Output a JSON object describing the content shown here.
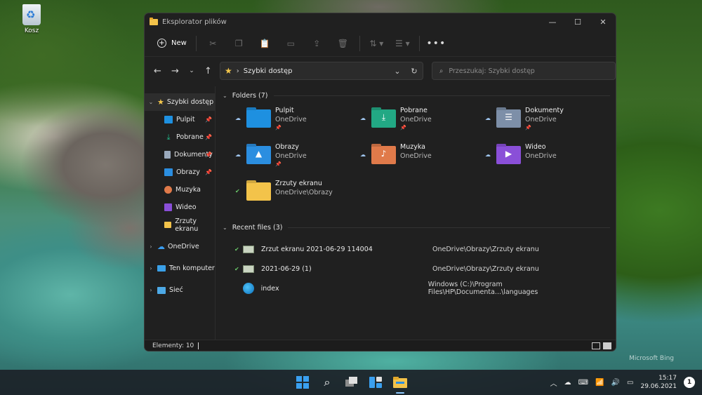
{
  "desktop": {
    "recycle_bin": "Kosz",
    "watermark": "Microsoft Bing"
  },
  "window": {
    "title": "Eksplorator plików"
  },
  "toolbar": {
    "new_label": "New",
    "more_label": "•••"
  },
  "address": {
    "path": "Szybki dostęp",
    "search_placeholder": "Przeszukaj: Szybki dostęp"
  },
  "sidebar": {
    "quick_access": "Szybki dostęp",
    "items": [
      {
        "label": "Pulpit",
        "pinned": true
      },
      {
        "label": "Pobrane",
        "pinned": true
      },
      {
        "label": "Dokumenty",
        "pinned": true
      },
      {
        "label": "Obrazy",
        "pinned": true
      },
      {
        "label": "Muzyka",
        "pinned": false
      },
      {
        "label": "Wideo",
        "pinned": false
      },
      {
        "label": "Zrzuty ekranu",
        "pinned": false
      }
    ],
    "onedrive": "OneDrive",
    "this_pc": "Ten komputer",
    "network": "Sieć"
  },
  "folders": {
    "header": "Folders (7)",
    "items": [
      {
        "name": "Pulpit",
        "location": "OneDrive",
        "color": "#1e90e0"
      },
      {
        "name": "Pobrane",
        "location": "OneDrive",
        "color": "#22a884"
      },
      {
        "name": "Dokumenty",
        "location": "OneDrive",
        "color": "#7d8fa8"
      },
      {
        "name": "Obrazy",
        "location": "OneDrive",
        "color": "#2b8ee0"
      },
      {
        "name": "Muzyka",
        "location": "OneDrive",
        "color": "#e07a4a"
      },
      {
        "name": "Wideo",
        "location": "OneDrive",
        "color": "#8a4fd8"
      },
      {
        "name": "Zrzuty ekranu",
        "location": "OneDrive\\Obrazy",
        "color": "#f3c34a"
      }
    ]
  },
  "recent": {
    "header": "Recent files (3)",
    "items": [
      {
        "name": "Zrzut ekranu 2021-06-29 114004",
        "location": "OneDrive\\Obrazy\\Zrzuty ekranu"
      },
      {
        "name": "2021-06-29 (1)",
        "location": "OneDrive\\Obrazy\\Zrzuty ekranu"
      },
      {
        "name": "index",
        "location": "Windows (C:)\\Program Files\\HP\\Documenta...\\languages"
      }
    ]
  },
  "status": {
    "count": "Elementy: 10"
  },
  "taskbar": {
    "time": "15:17",
    "date": "29.06.2021",
    "notifications": "1"
  }
}
